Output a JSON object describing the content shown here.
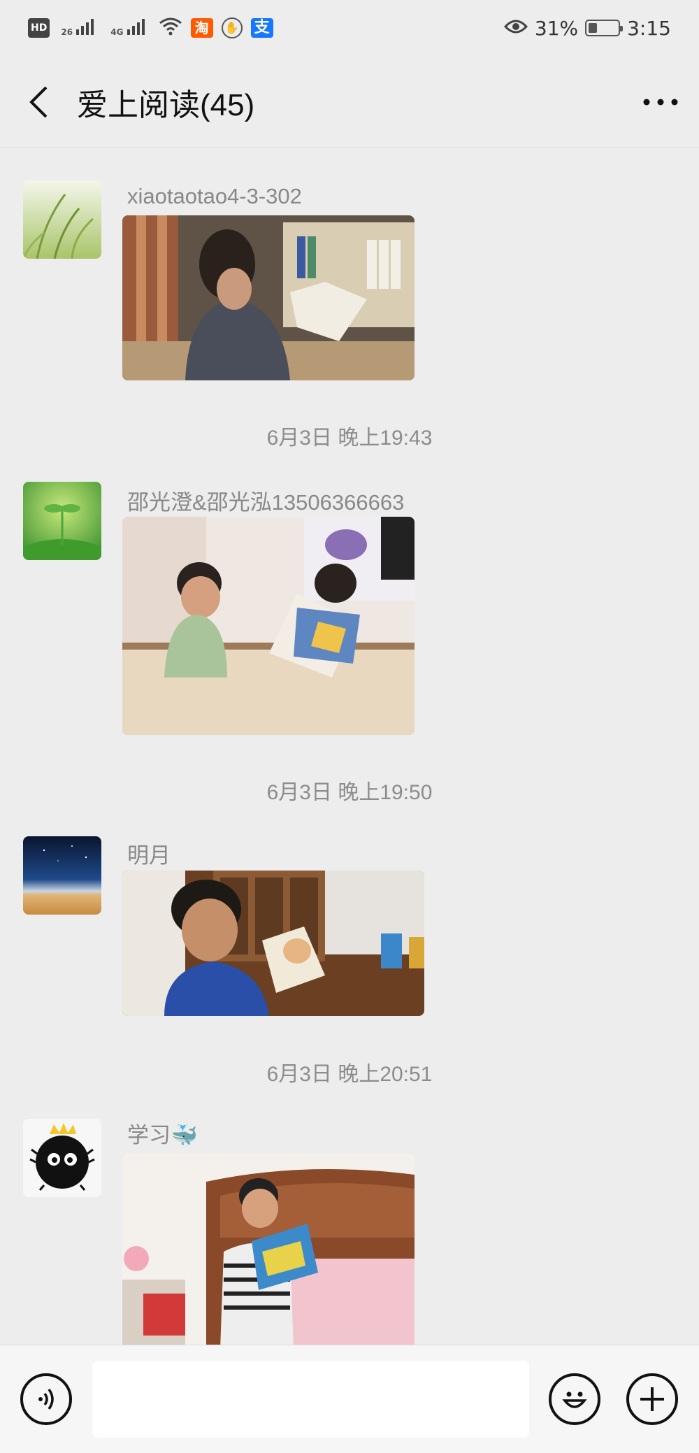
{
  "status_bar": {
    "left_icons": [
      "HD",
      "2G",
      "4G",
      "wifi-icon",
      "taobao-icon",
      "hand-icon",
      "alipay-icon"
    ],
    "hd_label": "HD",
    "sig1_label": "26",
    "sig2_label": "4G",
    "taobao_label": "淘",
    "alipay_label": "支",
    "battery_percent": "31%",
    "battery_level": 0.31,
    "time": "3:15"
  },
  "header": {
    "title": "爱上阅读(45)",
    "back_icon": "chevron-left-icon",
    "more_icon": "more-dots-icon"
  },
  "messages": [
    {
      "sender": "xiaotaotao4-3-302",
      "avatar": "grass-avatar",
      "photo": "girl-reading-photo"
    },
    {
      "timestamp": "6月3日 晚上19:43",
      "sender": "邵光澄&邵光泓13506366663",
      "avatar": "sprout-avatar",
      "photo": "two-boys-reading-photo"
    },
    {
      "timestamp": "6月3日 晚上19:50",
      "sender": "明月",
      "avatar": "night-sky-avatar",
      "photo": "boy-reading-photo"
    },
    {
      "timestamp": "6月3日 晚上20:51",
      "sender": "学习🐳",
      "avatar": "soot-sprite-avatar",
      "photo": "child-on-bed-photo"
    }
  ],
  "input_bar": {
    "voice_icon": "voice-icon",
    "emoji_icon": "emoji-icon",
    "plus_icon": "plus-icon",
    "placeholder": ""
  }
}
